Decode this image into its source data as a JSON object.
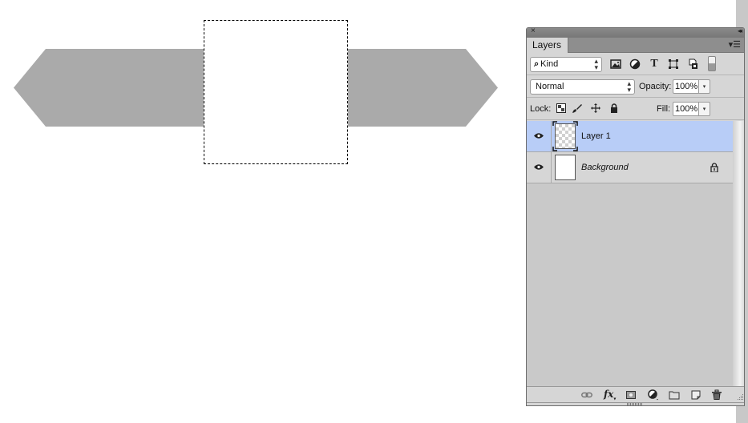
{
  "canvas": {
    "shape_color": "#aaaaaa",
    "selection": "marquee"
  },
  "panel": {
    "close_glyph": "×",
    "collapse_glyph": "◂◂",
    "tab_label": "Layers",
    "menu_glyph": "▾☰",
    "filter": {
      "kind_icon": "search-icon",
      "kind_label": "Kind",
      "icons": [
        "pixel-layer-filter-icon",
        "adjustment-layer-filter-icon",
        "type-layer-filter-icon",
        "shape-layer-filter-icon",
        "smart-object-filter-icon"
      ],
      "type_glyph": "T"
    },
    "blend_mode": "Normal",
    "opacity_label": "Opacity:",
    "opacity_value": "100%",
    "lock_label": "Lock:",
    "lock_icons": [
      "lock-transparent-icon",
      "lock-paint-icon",
      "lock-position-icon",
      "lock-all-icon"
    ],
    "fill_label": "Fill:",
    "fill_value": "100%",
    "dropdown_glyph": "▾",
    "select_arrows": "⬍",
    "layers": [
      {
        "name": "Layer 1",
        "visible": true,
        "selected": true,
        "locked": false,
        "italic": false,
        "thumbnail": "transparent"
      },
      {
        "name": "Background",
        "visible": true,
        "selected": false,
        "locked": true,
        "italic": true,
        "thumbnail": "white"
      }
    ],
    "selection_color": "#b8cdf7",
    "footer_icons": [
      "link-layers-icon",
      "fx-icon",
      "add-mask-icon",
      "adjustment-layer-icon",
      "new-group-icon",
      "new-layer-icon",
      "trash-icon"
    ],
    "fx_label": "fx"
  }
}
